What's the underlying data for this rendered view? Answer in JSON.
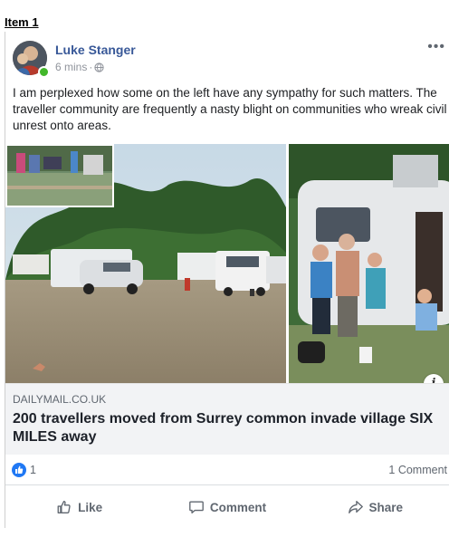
{
  "item_label": "Item 1",
  "post": {
    "author": "Luke Stanger",
    "time": "6 mins",
    "separator": "·",
    "more": "•••",
    "text": "I am perplexed how some on the left have any sympathy for such matters. The traveller community are frequently a nasty blight on communities who wreak civil unrest onto areas."
  },
  "link": {
    "source": "DAILYMAIL.CO.UK",
    "title": "200 travellers moved from Surrey common invade village SIX MILES away",
    "info": "i"
  },
  "stats": {
    "likes": "1",
    "comments": "1 Comment"
  },
  "actions": {
    "like": "Like",
    "comment": "Comment",
    "share": "Share"
  },
  "colors": {
    "author": "#385898",
    "like_blue": "#2078f4",
    "online_green": "#42b72a",
    "link_bg": "#f2f3f5"
  },
  "icons": [
    "globe-icon",
    "more-icon",
    "info-icon",
    "like-reaction-icon",
    "thumbs-up-icon",
    "comment-bubble-icon",
    "share-arrow-icon"
  ]
}
